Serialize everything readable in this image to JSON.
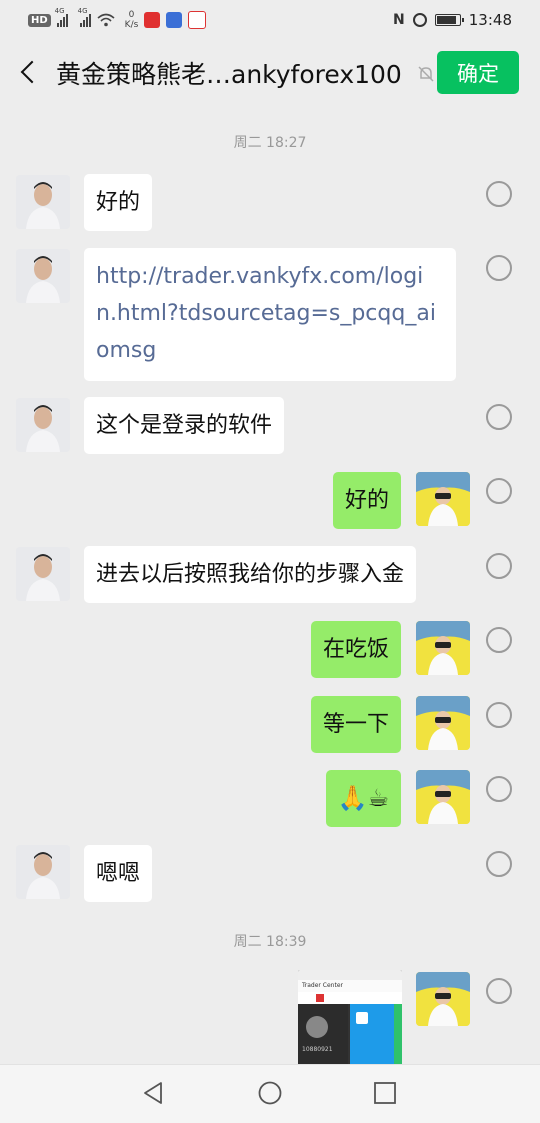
{
  "status_bar": {
    "hd_badge": "HD",
    "network_1": "4G",
    "network_2": "4G",
    "speed_value": "0",
    "speed_unit": "K/s",
    "time": "13:48",
    "nfc": "N"
  },
  "header": {
    "title": "黄金策略熊老…ankyforex100",
    "confirm_label": "确定"
  },
  "timestamps": [
    "周二 18:27",
    "周二 18:39"
  ],
  "messages": [
    {
      "side": "in",
      "text": "好的"
    },
    {
      "side": "in",
      "type": "link",
      "text": "http://trader.vankyfx.com/login.html?tdsourcetag=s_pcqq_aiomsg"
    },
    {
      "side": "in",
      "text": "这个是登录的软件"
    },
    {
      "side": "out",
      "text": "好的"
    },
    {
      "side": "in",
      "text": "进去以后按照我给你的步骤入金"
    },
    {
      "side": "out",
      "text": "在吃饭"
    },
    {
      "side": "out",
      "text": "等一下"
    },
    {
      "side": "out",
      "text": "🙏☕"
    },
    {
      "side": "in",
      "text": "嗯嗯"
    },
    {
      "side": "out",
      "type": "image",
      "text": ""
    }
  ],
  "screenshot_thumb": {
    "title": "Trader Center",
    "number": "10880921"
  },
  "colors": {
    "background": "#ededed",
    "outgoing_bubble": "#95ec69",
    "incoming_bubble": "#ffffff",
    "confirm_button": "#07c160",
    "link": "#576b95"
  }
}
